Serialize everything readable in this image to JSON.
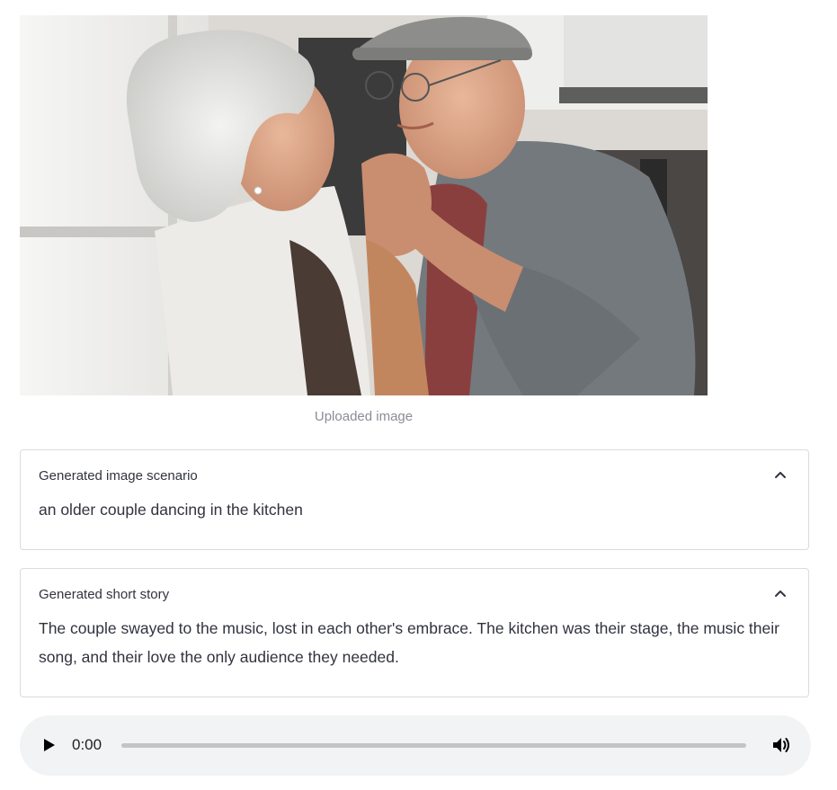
{
  "uploaded_image": {
    "caption": "Uploaded image"
  },
  "scenario": {
    "title": "Generated image scenario",
    "text": "an older couple dancing in the kitchen",
    "expanded": true
  },
  "story": {
    "title": "Generated short story",
    "text": "The couple swayed to the music, lost in each other's embrace. The kitchen was their stage, the music their song, and their love the only audience they needed.",
    "expanded": true
  },
  "audio_player": {
    "current_time": "0:00",
    "progress": 0,
    "play_icon": "play-icon",
    "volume_icon": "volume-icon"
  }
}
